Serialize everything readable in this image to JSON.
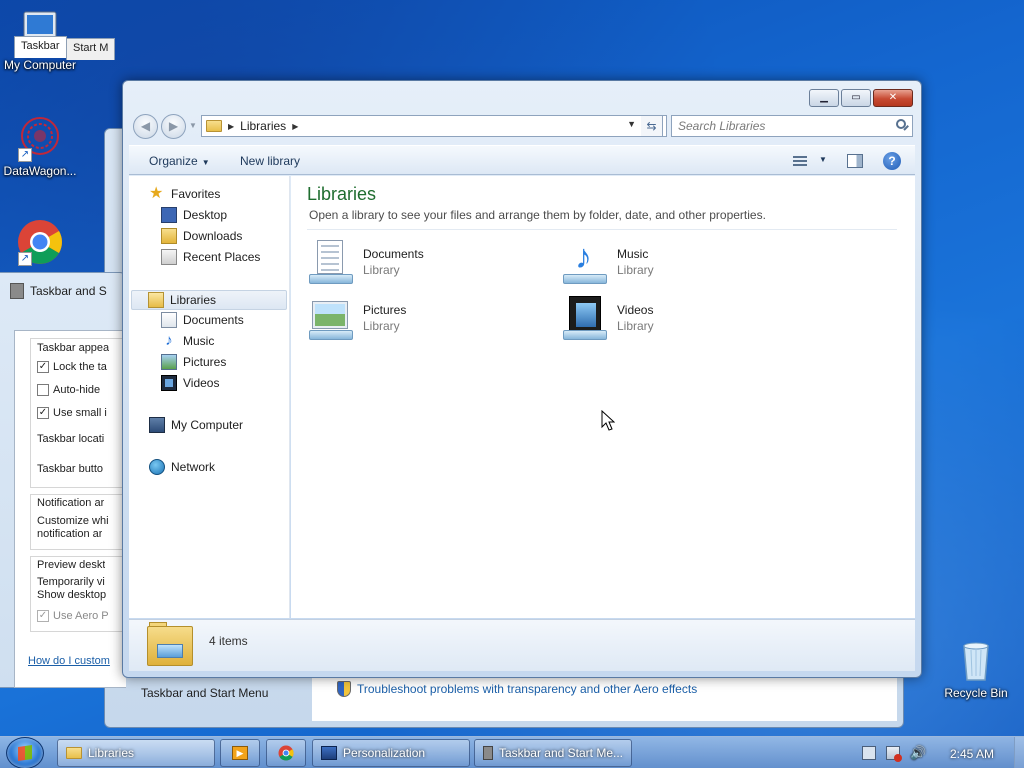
{
  "desktop": {
    "icons": [
      {
        "label": "My Computer",
        "icon": "computer-icon"
      },
      {
        "label": "DataWagon...",
        "icon": "datawagon-icon"
      },
      {
        "label": "",
        "icon": "chrome-icon"
      },
      {
        "label": "Recycle Bin",
        "icon": "recycle-bin-icon"
      }
    ]
  },
  "back_window": {
    "caption": "Taskbar and Start Menu",
    "link": "Troubleshoot problems with transparency and other Aero effects"
  },
  "tsm_dialog": {
    "title": "Taskbar and S",
    "tabs": [
      "Taskbar",
      "Start M"
    ],
    "section_appearance": "Taskbar appea",
    "lock": "Lock the ta",
    "autohide": "Auto-hide",
    "small_icons": "Use small i",
    "location": "Taskbar locati",
    "buttons": "Taskbar butto",
    "notification_title": "Notification ar",
    "notification_line1": "Customize whi",
    "notification_line2": "notification ar",
    "preview_title": "Preview deskt",
    "preview_line1": "Temporarily vi",
    "preview_line2": "Show desktop",
    "aero_peek": "Use Aero P",
    "help_link": "How do I custom"
  },
  "explorer": {
    "address_label": "Libraries",
    "search_placeholder": "Search Libraries",
    "toolbar": {
      "organize": "Organize",
      "new_library": "New library"
    },
    "nav": {
      "favorites": "Favorites",
      "desktop": "Desktop",
      "downloads": "Downloads",
      "recent_places": "Recent Places",
      "libraries": "Libraries",
      "documents": "Documents",
      "music": "Music",
      "pictures": "Pictures",
      "videos": "Videos",
      "my_computer": "My Computer",
      "network": "Network"
    },
    "content": {
      "title": "Libraries",
      "subtitle": "Open a library to see your files and arrange them by folder, date, and other properties.",
      "items": [
        {
          "name": "Documents",
          "kind": "Library"
        },
        {
          "name": "Music",
          "kind": "Library"
        },
        {
          "name": "Pictures",
          "kind": "Library"
        },
        {
          "name": "Videos",
          "kind": "Library"
        }
      ]
    },
    "details": {
      "count": "4 items"
    }
  },
  "taskbar": {
    "buttons": [
      {
        "label": "Libraries",
        "active": true
      },
      {
        "label": "",
        "icon": "media-player-icon"
      },
      {
        "label": "",
        "icon": "chrome-icon"
      },
      {
        "label": "Personalization"
      },
      {
        "label": "Taskbar and Start Me..."
      }
    ],
    "clock": "2:45 AM"
  }
}
